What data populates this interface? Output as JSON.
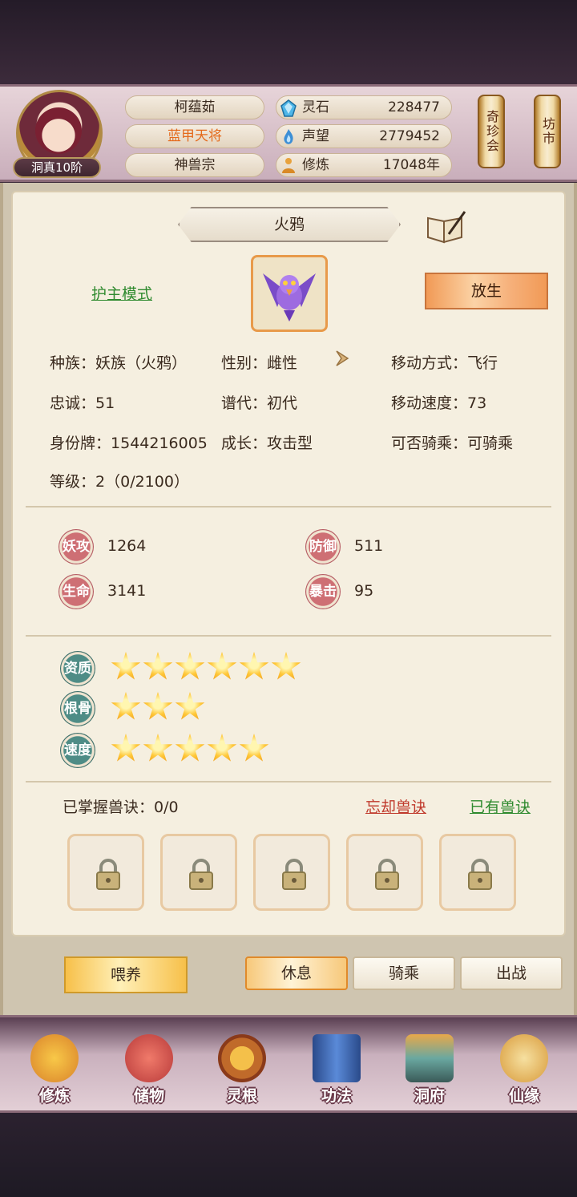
{
  "player": {
    "name": "柯蕴茹",
    "title": "蓝甲天将",
    "title_color": "#e46a1c",
    "sect": "神兽宗",
    "rank": "洞真10阶"
  },
  "resources": [
    {
      "label": "灵石",
      "value": "228477",
      "icon": "spirit-stone-icon"
    },
    {
      "label": "声望",
      "value": "2779452",
      "icon": "reputation-flame-icon"
    },
    {
      "label": "修炼",
      "value": "17048年",
      "icon": "meditation-icon"
    }
  ],
  "side_buttons": {
    "treasure": "奇珍会",
    "market": "坊市"
  },
  "pet": {
    "name": "火鸦",
    "guard_mode": "护主模式",
    "release": "放生",
    "info": [
      {
        "label": "种族：",
        "value": "妖族（火鸦）"
      },
      {
        "label": "性别：",
        "value": "雌性"
      },
      {
        "label": "移动方式：",
        "value": "飞行"
      },
      {
        "label": "忠诚：",
        "value": "51"
      },
      {
        "label": "谱代：",
        "value": "初代"
      },
      {
        "label": "移动速度：",
        "value": "73"
      },
      {
        "label": "身份牌：",
        "value": "1544216005"
      },
      {
        "label": "成长：",
        "value": "攻击型"
      },
      {
        "label": "可否骑乘：",
        "value": "可骑乘"
      },
      {
        "label": "等级：",
        "value": "2（0/2100）"
      }
    ],
    "stats": [
      {
        "label": "妖攻",
        "value": "1264"
      },
      {
        "label": "防御",
        "value": "511"
      },
      {
        "label": "生命",
        "value": "3141"
      },
      {
        "label": "暴击",
        "value": "95"
      }
    ],
    "ratings": [
      {
        "label": "资质",
        "stars": 6
      },
      {
        "label": "根骨",
        "stars": 3
      },
      {
        "label": "速度",
        "stars": 5
      }
    ],
    "skills": {
      "mastered": "已掌握兽诀：0/0",
      "forget": "忘却兽诀",
      "owned": "已有兽诀",
      "slots": 5
    }
  },
  "actions": {
    "feed": "喂养",
    "rest": "休息",
    "ride": "骑乘",
    "fight": "出战",
    "active": "rest"
  },
  "nav": [
    "修炼",
    "储物",
    "灵根",
    "功法",
    "洞府",
    "仙缘"
  ]
}
